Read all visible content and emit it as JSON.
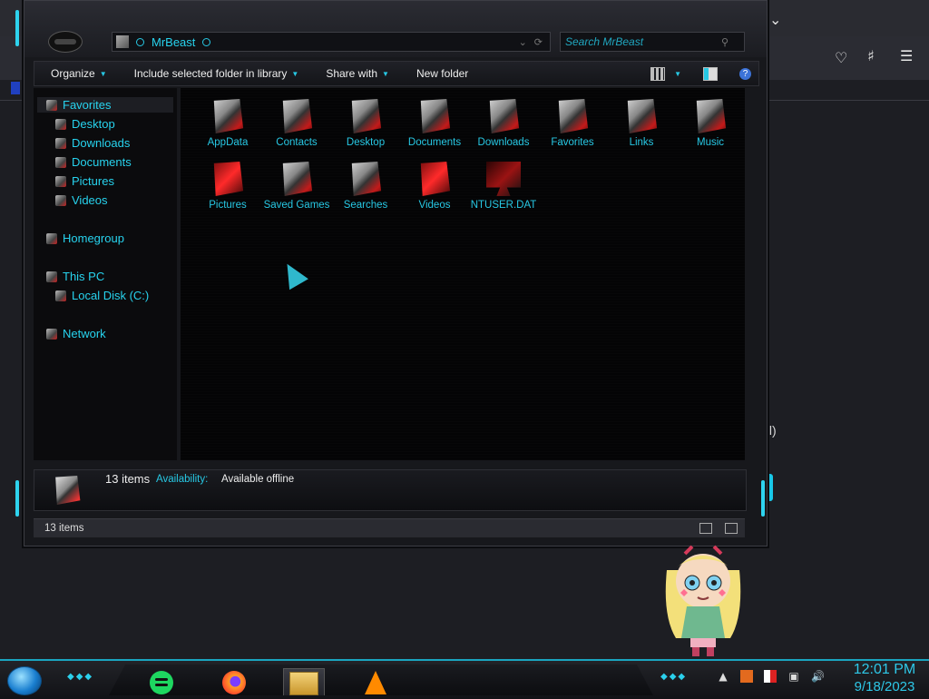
{
  "window": {
    "address": "MrBeast",
    "search_placeholder": "Search MrBeast"
  },
  "toolbar": {
    "organize": "Organize",
    "include_library": "Include selected folder in library",
    "share_with": "Share with",
    "new_folder": "New folder"
  },
  "nav": {
    "favorites": "Favorites",
    "desktop": "Desktop",
    "downloads": "Downloads",
    "documents": "Documents",
    "pictures": "Pictures",
    "videos": "Videos",
    "homegroup": "Homegroup",
    "this_pc": "This PC",
    "local_disk": "Local Disk (C:)",
    "network": "Network"
  },
  "files": [
    {
      "label": "AppData"
    },
    {
      "label": "Contacts"
    },
    {
      "label": "Desktop"
    },
    {
      "label": "Documents"
    },
    {
      "label": "Downloads"
    },
    {
      "label": "Favorites"
    },
    {
      "label": "Links"
    },
    {
      "label": "Music"
    },
    {
      "label": "Pictures"
    },
    {
      "label": "Saved Games"
    },
    {
      "label": "Searches"
    },
    {
      "label": "Videos"
    },
    {
      "label": "NTUSER.DAT"
    }
  ],
  "details": {
    "count": "13 items",
    "availability_label": "Availability:",
    "availability_value": "Available offline"
  },
  "status": {
    "text": "13 items"
  },
  "background": {
    "partial_text": "all)"
  },
  "taskbar": {
    "time": "12:01 PM",
    "date": "9/18/2023"
  },
  "colors": {
    "accent": "#27d3ee",
    "frame": "#17181c",
    "content_bg": "#040405"
  }
}
